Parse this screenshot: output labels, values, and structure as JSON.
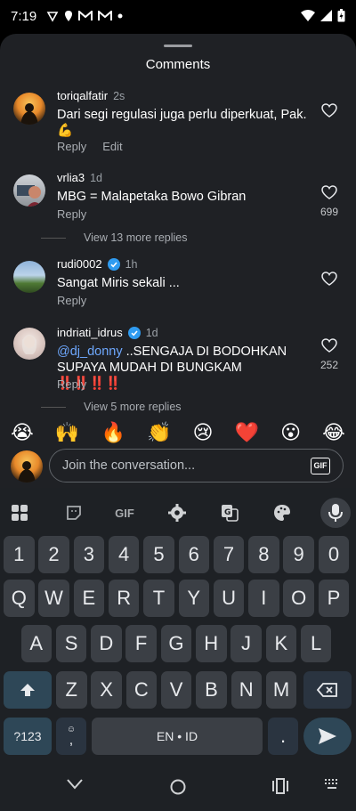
{
  "status": {
    "time": "7:19",
    "icons": [
      "tiktok-icon",
      "location-icon",
      "gmail-icon",
      "gmail-icon",
      "dot-icon"
    ]
  },
  "sheet": {
    "title": "Comments"
  },
  "comments": [
    {
      "user": "toriqalfatir",
      "ago": "2s",
      "text": "Dari segi regulasi juga perlu diperkuat, Pak. 💪",
      "reply": "Reply",
      "edit": "Edit",
      "likes": ""
    },
    {
      "user": "vrlia3",
      "ago": "1d",
      "text": "MBG = Malapetaka Bowo Gibran",
      "reply": "Reply",
      "likes": "699",
      "more_replies": "View 13 more replies"
    },
    {
      "user": "rudi0002",
      "ago": "1h",
      "text": "Sangat Miris sekali ...",
      "reply": "Reply",
      "likes": ""
    },
    {
      "user": "indriati_idrus",
      "ago": "1d",
      "mention": "@dj_donny",
      "text": " ..SENGAJA DI BODOHKAN SUPAYA MUDAH DI BUNGKAM ‼️‼️‼️‼️",
      "reply": "Reply",
      "likes": "252",
      "more_replies": "View 5 more replies"
    }
  ],
  "emojis": [
    "😭",
    "🙌",
    "🔥",
    "👏",
    "😢",
    "❤️",
    "😮",
    "😂"
  ],
  "input": {
    "placeholder": "Join the conversation...",
    "gif": "GIF"
  },
  "keyboard": {
    "toolbar_gif": "GIF",
    "row_numbers": [
      "1",
      "2",
      "3",
      "4",
      "5",
      "6",
      "7",
      "8",
      "9",
      "0"
    ],
    "row1": [
      "Q",
      "W",
      "E",
      "R",
      "T",
      "Y",
      "U",
      "I",
      "O",
      "P"
    ],
    "row2": [
      "A",
      "S",
      "D",
      "F",
      "G",
      "H",
      "J",
      "K",
      "L"
    ],
    "row3": [
      "Z",
      "X",
      "C",
      "V",
      "B",
      "N",
      "M"
    ],
    "sym_key": "?123",
    "comma_key": ",",
    "space_label": "EN • ID",
    "period_key": "."
  }
}
